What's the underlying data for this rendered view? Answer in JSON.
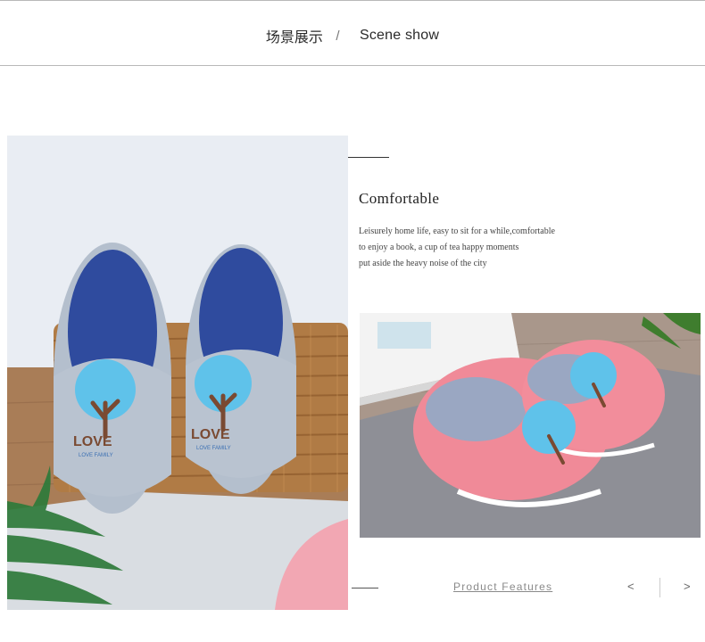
{
  "header": {
    "title_zh": "场景展示",
    "separator": "/",
    "title_en": "Scene show"
  },
  "feature": {
    "title": "Comfortable",
    "lines": [
      "Leisurely home life, easy to sit for a while,comfortable",
      "to enjoy a book, a cup of tea happy moments",
      "put aside the heavy noise of the city"
    ]
  },
  "photo_left": {
    "love_text": "LOVE",
    "family_text": "LOVE FAMILY"
  },
  "footer": {
    "link_label": "Product Features",
    "prev_label": "<",
    "next_label": ">"
  },
  "colors": {
    "accent_blue": "#5fc2ea",
    "slipper_grey": "#b4bfcd",
    "slipper_insole": "#2f4b9e",
    "slipper_pink": "#f08a98"
  }
}
